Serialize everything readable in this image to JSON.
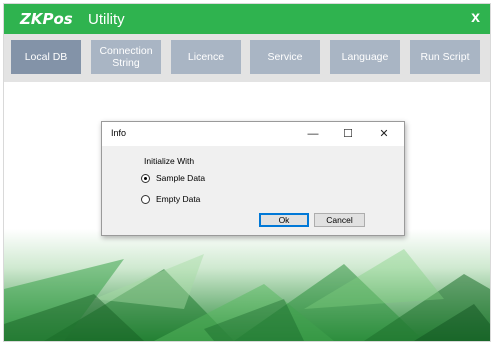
{
  "app": {
    "logo": "ZKPos",
    "title": "Utility",
    "close_label": "x"
  },
  "nav": {
    "items": [
      {
        "label": "Local DB"
      },
      {
        "label": "Connection String"
      },
      {
        "label": "Licence"
      },
      {
        "label": "Service"
      },
      {
        "label": "Language"
      },
      {
        "label": "Run Script"
      }
    ]
  },
  "dialog": {
    "title": "Info",
    "minimize": "—",
    "maximize": "☐",
    "close": "✕",
    "group_label": "Initialize With",
    "options": [
      {
        "label": "Sample Data",
        "checked": true
      },
      {
        "label": "Empty Data",
        "checked": false
      }
    ],
    "ok_label": "Ok",
    "cancel_label": "Cancel"
  },
  "colors": {
    "titlebar": "#2fb34f",
    "nav_button": "#a9b5c4",
    "nav_button_active": "#8393a8"
  }
}
